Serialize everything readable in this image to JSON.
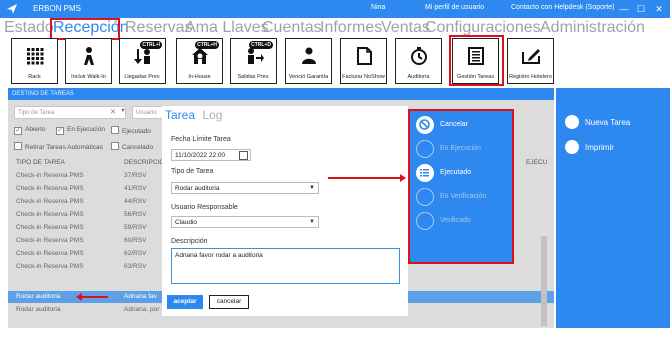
{
  "titlebar": {
    "app_title": "ERBON PMS",
    "user": "Nina",
    "profile": "Mi perfil de usuario",
    "support": "Contacto con Helpdesk (Soporte)",
    "minimize": "—",
    "maximize": "☐",
    "close": "✕"
  },
  "menu": {
    "items": [
      "Estado",
      "Recepción",
      "Reservas",
      "Ama Llaves",
      "Cuentas",
      "Informes",
      "Ventas",
      "Configuraciones",
      "Administración"
    ],
    "active": "Recepción"
  },
  "toolbar": {
    "items": [
      {
        "label": "Rack",
        "icon": "rack-grid-icon",
        "shortcut": ""
      },
      {
        "label": "Incluir Walk-In",
        "icon": "walk-in-icon",
        "shortcut": ""
      },
      {
        "label": "Llegadas Prev.",
        "icon": "arrivals-icon",
        "shortcut": "CTRL+I"
      },
      {
        "label": "In-House",
        "icon": "in-house-icon",
        "shortcut": "CTRL+H"
      },
      {
        "label": "Salidas Prev.",
        "icon": "departures-icon",
        "shortcut": "CTRL+D"
      },
      {
        "label": "Venció Garantía",
        "icon": "guarantee-expired-icon",
        "shortcut": ""
      },
      {
        "label": "Facturar NoShow",
        "icon": "invoice-noshow-icon",
        "shortcut": ""
      },
      {
        "label": "Auditoría",
        "icon": "audit-icon",
        "shortcut": ""
      },
      {
        "label": "Gestión Tareas",
        "icon": "task-management-icon",
        "shortcut": ""
      },
      {
        "label": "Registro Hotelero",
        "icon": "hotel-register-icon",
        "shortcut": ""
      }
    ]
  },
  "panel": {
    "header": "DESTINO DE TAREAS",
    "filter_type_placeholder": "Tipo de Tarea",
    "filter_user_placeholder": "Usuario",
    "checkboxes": [
      {
        "label": "Abierto",
        "checked": true
      },
      {
        "label": "En Ejecución",
        "checked": true
      },
      {
        "label": "Ejecutado",
        "checked": false
      },
      {
        "label": "Retirar Tareas Automáticas",
        "checked": false
      },
      {
        "label": "Cancelado",
        "checked": false
      }
    ],
    "columns": [
      "TIPO DE TAREA",
      "DESCRIPCIÓN",
      "EJECU"
    ],
    "rows": [
      {
        "type": "Check-in Reserva PMS",
        "desc": "37/RSV",
        "selected": false
      },
      {
        "type": "Check-in Reserva PMS",
        "desc": "41/RSV",
        "selected": false
      },
      {
        "type": "Check-in Reserva PMS",
        "desc": "44/RSV",
        "selected": false
      },
      {
        "type": "Check-in Reserva PMS",
        "desc": "56/RSV",
        "selected": false
      },
      {
        "type": "Check-in Reserva PMS",
        "desc": "59/RSV",
        "selected": false
      },
      {
        "type": "Check-in Reserva PMS",
        "desc": "60/RSV",
        "selected": false
      },
      {
        "type": "Check-in Reserva PMS",
        "desc": "62/RSV",
        "selected": false
      },
      {
        "type": "Check-in Reserva PMS",
        "desc": "63/RSV",
        "selected": false
      },
      {
        "type": "Rodar auditoria",
        "desc": "Adriana fav",
        "selected": true
      },
      {
        "type": "Rodar auditoria",
        "desc": "Adriana, por",
        "selected": false
      }
    ],
    "side_new": "Nueva Tarea",
    "side_print": "Imprimir"
  },
  "modal": {
    "tabs": [
      "Tarea",
      "Log"
    ],
    "active_tab": "Tarea",
    "deadline_label": "Fecha Límite Tarea",
    "deadline_value": "11/10/2022 22:00",
    "task_type_label": "Tipo de Tarea",
    "task_type_value": "Rodar auditoria",
    "user_label": "Usuario Responsable",
    "user_value": "Claudio",
    "desc_label": "Descripción",
    "desc_value": "Adriana favor rodar a auditoria",
    "ok": "aceptar",
    "cancel": "cancelar"
  },
  "status_actions": [
    {
      "label": "Cancelar",
      "icon": "cancel-circle-icon",
      "enabled": true
    },
    {
      "label": "En Ejecución",
      "icon": "list-check-icon",
      "enabled": false
    },
    {
      "label": "Ejecutado",
      "icon": "list-check-icon",
      "enabled": true
    },
    {
      "label": "En Verificación",
      "icon": "list-check-icon",
      "enabled": false
    },
    {
      "label": "Verificado",
      "icon": "list-check-icon",
      "enabled": false
    }
  ],
  "colors": {
    "accent": "#2d89ef",
    "highlight": "#e0101a",
    "panel_bg": "#dcdcdc"
  }
}
